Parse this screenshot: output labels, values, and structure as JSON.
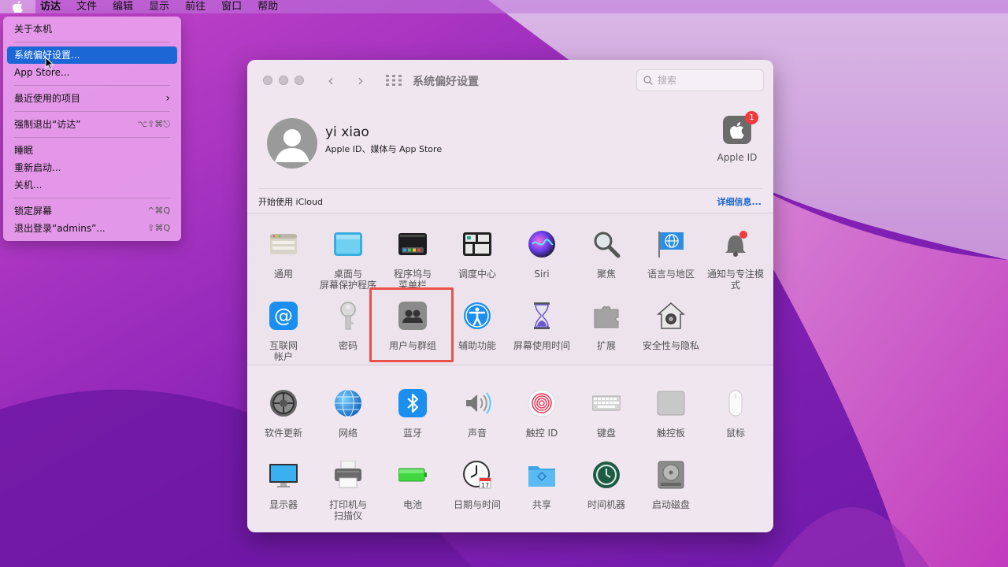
{
  "menubar": {
    "items": [
      "访达",
      "文件",
      "编辑",
      "显示",
      "前往",
      "窗口",
      "帮助"
    ]
  },
  "apple_menu": {
    "about": "关于本机",
    "system_prefs": "系统偏好设置...",
    "app_store": "App Store...",
    "recent_items": "最近使用的项目",
    "force_quit": "强制退出“访达”",
    "force_quit_shortcut": "⌥⇧⌘⎋",
    "sleep": "睡眠",
    "restart": "重新启动...",
    "shutdown": "关机...",
    "lock_screen": "锁定屏幕",
    "lock_shortcut": "^⌘Q",
    "logout": "退出登录“admins”...",
    "logout_shortcut": "⇧⌘Q"
  },
  "window": {
    "title": "系统偏好设置",
    "search_placeholder": "搜索"
  },
  "user": {
    "name": "yi xiao",
    "subtitle": "Apple ID、媒体与 App Store",
    "apple_id_label": "Apple ID",
    "badge_count": "1"
  },
  "icloud": {
    "prompt": "开始使用 iCloud",
    "details": "详细信息..."
  },
  "panes_row1": [
    {
      "label": "通用",
      "icon": "general-icon"
    },
    {
      "label": "桌面与\n屏幕保护程序",
      "icon": "desktop-icon"
    },
    {
      "label": "程序坞与\n菜单栏",
      "icon": "dock-icon"
    },
    {
      "label": "调度中心",
      "icon": "mission-control-icon"
    },
    {
      "label": "Siri",
      "icon": "siri-icon"
    },
    {
      "label": "聚焦",
      "icon": "spotlight-icon"
    },
    {
      "label": "语言与地区",
      "icon": "language-icon"
    },
    {
      "label": "通知与专注模式",
      "icon": "notifications-icon"
    }
  ],
  "panes_row2": [
    {
      "label": "互联网\n帐户",
      "icon": "internet-accounts-icon"
    },
    {
      "label": "密码",
      "icon": "passwords-icon"
    },
    {
      "label": "用户与群组",
      "icon": "users-groups-icon"
    },
    {
      "label": "辅助功能",
      "icon": "accessibility-icon"
    },
    {
      "label": "屏幕使用时间",
      "icon": "screen-time-icon"
    },
    {
      "label": "扩展",
      "icon": "extensions-icon"
    },
    {
      "label": "安全性与隐私",
      "icon": "security-icon"
    }
  ],
  "panes_row3": [
    {
      "label": "软件更新",
      "icon": "software-update-icon"
    },
    {
      "label": "网络",
      "icon": "network-icon"
    },
    {
      "label": "蓝牙",
      "icon": "bluetooth-icon"
    },
    {
      "label": "声音",
      "icon": "sound-icon"
    },
    {
      "label": "触控 ID",
      "icon": "touch-id-icon"
    },
    {
      "label": "键盘",
      "icon": "keyboard-icon"
    },
    {
      "label": "触控板",
      "icon": "trackpad-icon"
    },
    {
      "label": "鼠标",
      "icon": "mouse-icon"
    }
  ],
  "panes_row4": [
    {
      "label": "显示器",
      "icon": "displays-icon"
    },
    {
      "label": "打印机与\n扫描仪",
      "icon": "printers-icon"
    },
    {
      "label": "电池",
      "icon": "battery-icon"
    },
    {
      "label": "日期与时间",
      "icon": "date-time-icon"
    },
    {
      "label": "共享",
      "icon": "sharing-icon"
    },
    {
      "label": "时间机器",
      "icon": "time-machine-icon"
    },
    {
      "label": "启动磁盘",
      "icon": "startup-disk-icon"
    }
  ],
  "calendar_day": "17",
  "colors": {
    "accent": "#1b67d6",
    "highlight_box": "#e8524a",
    "badge": "#ef3b3b"
  }
}
